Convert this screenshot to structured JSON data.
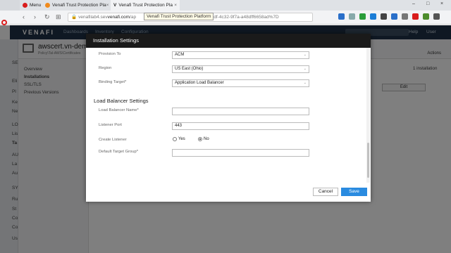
{
  "browser": {
    "menu_label": "Menu",
    "tabs": [
      {
        "title": "Venafi Trust Protection Pla",
        "close": "×"
      },
      {
        "title": "Venafi Trust Protection Pla",
        "close": "×"
      }
    ],
    "url_prefix": "venafilab4.sev",
    "url_host": "venafi.com",
    "url_rest": "/ap",
    "url_tail": "87f6b4ad0-e5df-4c32-9f7a-a48dff6658ad%7D",
    "tooltip": "Venafi Trust Protection Platform",
    "window_controls": [
      "–",
      "□",
      "×"
    ]
  },
  "app": {
    "logo": "VENAFI",
    "nav": [
      "Dashboards",
      "Inventory",
      "Configuration"
    ],
    "help": "Help",
    "user": "User",
    "page_title": "awscert.vn-dem",
    "page_subtitle": "Policy\\Tal-AWS\\Certificates",
    "actions_label": "Actions",
    "left_rail": [
      "SE",
      "Eli",
      "Pl",
      "Ke",
      "Ne",
      "LO",
      "Lis",
      "Ta",
      "AU",
      "La",
      "Au",
      "SY",
      "Ru",
      "St",
      "Co",
      "Co",
      "Us"
    ],
    "subnav": [
      "Overview",
      "Installations",
      "SSL/TLS",
      "Previous Versions"
    ],
    "install_count": "1 installation",
    "edit_label": "Edit"
  },
  "modal": {
    "title": "Installation Settings",
    "fields": {
      "provision_to": {
        "label": "Provision To",
        "value": "ACM"
      },
      "region": {
        "label": "Region",
        "value": "US East (Ohio)"
      },
      "binding_target": {
        "label": "Binding Target*",
        "value": "Application Load Balancer"
      }
    },
    "lb_section_title": "Load Balancer Settings",
    "lb_fields": {
      "lb_name": {
        "label": "Load Balancer Name*",
        "value": ""
      },
      "listener_port": {
        "label": "Listener Port",
        "value": "443"
      },
      "create_listener": {
        "label": "Create Listener",
        "yes": "Yes",
        "no": "No",
        "selected": "No"
      },
      "default_target_group": {
        "label": "Default Target Group*",
        "value": ""
      }
    },
    "cancel_label": "Cancel",
    "save_label": "Save"
  },
  "colors": {
    "app_header": "#1f3146",
    "modal_header": "#1a1a1a",
    "save_button": "#2a8be0"
  }
}
